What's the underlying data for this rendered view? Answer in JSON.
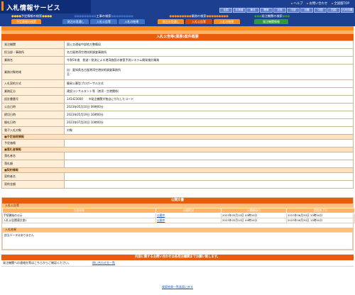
{
  "app_title": "入札情報サービス",
  "util_links": [
    "ヘルプ",
    "お問い合わせ",
    "全国版TOP"
  ],
  "regions": [
    "全国",
    "北海道",
    "東北",
    "関東",
    "北陸",
    "中部",
    "近畿",
    "中国",
    "四国",
    "九州沖縄"
  ],
  "nav_sections": [
    {
      "label": "予定情報の検索",
      "color": "#0d3b8c",
      "tabs": [
        {
          "label": "予定情報の検索",
          "color": "#ff8c1a"
        }
      ]
    },
    {
      "label": "工事の検索",
      "color": "#0d3b8c",
      "tabs": [
        {
          "label": "発注の見通し",
          "color": "#3a73c8"
        },
        {
          "label": "入札公告等",
          "color": "#3a73c8"
        },
        {
          "label": "入札の結果",
          "color": "#3a73c8"
        }
      ]
    },
    {
      "label": "業務の検索",
      "color": "#d64a00",
      "tabs": [
        {
          "label": "発注の見通し",
          "color": "#ff8c1a"
        },
        {
          "label": "入札公告等",
          "color": "#d64a00"
        },
        {
          "label": "入札の結果",
          "color": "#ff8c1a"
        }
      ]
    },
    {
      "label": "発注機関の検索",
      "color": "#0d3b8c",
      "tabs": [
        {
          "label": "発注機関情報",
          "color": "#2e9a3b"
        }
      ]
    }
  ],
  "main": {
    "banner": "入札公告等(業務)案件概要",
    "rows": [
      {
        "label": "発注機関",
        "value": "国土交通省中部地方整備局"
      },
      {
        "label": "担当部・事務所",
        "value": "名古屋港湾空港技術調査事務所"
      },
      {
        "label": "業務名",
        "value": "令和5年度　鋭波・鋭流による港湾施設の被害予測システム開発検討業務"
      },
      {
        "label": "業務対象地域",
        "value": "自：愛知県名古屋港湾空港技術調査事務所\n至："
      },
      {
        "label": "入札契約方式",
        "value": "簡易公募型プロポーザル方式"
      },
      {
        "label": "業務区分",
        "value": "建設コンサルタント等（港湾・空港関係）"
      },
      {
        "label": "設計書番号",
        "value": "141423000　　※発注機関が独自に付与したコード"
      },
      {
        "label": "公告日時",
        "value": "2023年05月10日 09時00分"
      },
      {
        "label": "締切日時",
        "value": "2023年05月19日 16時00分"
      },
      {
        "label": "開札日時",
        "value": "2023年07月20日 10時00分"
      },
      {
        "label": "電子入札対象",
        "value": "対象"
      },
      {
        "section": "■予定価格情報"
      },
      {
        "label": "予定価格",
        "value": ""
      },
      {
        "section": "■落札者情報"
      },
      {
        "label": "落札者名",
        "value": ""
      },
      {
        "label": "落札額",
        "value": ""
      },
      {
        "section": "■契約情報"
      },
      {
        "label": "契約者名",
        "value": ""
      },
      {
        "label": "契約金額",
        "value": ""
      }
    ]
  },
  "publications": {
    "header": "公開文書",
    "sub_header": "入札公告等",
    "columns": [
      "文書名称",
      "公開状況",
      "公開開始日",
      "閲覧終了日"
    ],
    "items": [
      {
        "name": "手続開始の公示",
        "status": "公開中",
        "start": "2023年05月10日 09時00分",
        "end": "2023年06月30日 10時00分"
      },
      {
        "name": "入札公告関連文書1",
        "status": "公開中",
        "start": "2023年05月10日 09時00分",
        "end": "2023年06月30日 10時00分"
      }
    ]
  },
  "remarks": {
    "label": "入札結果",
    "text": "該当データはありません"
  },
  "contact": {
    "header": "内容に関するお問い合わせは各発注機関までお願い致します。",
    "text": "発注機関への連絡先等はこちらからご確認ください。",
    "link_label": "問い合わせ先一覧"
  },
  "back_link": "検索結果一覧画面に戻る"
}
